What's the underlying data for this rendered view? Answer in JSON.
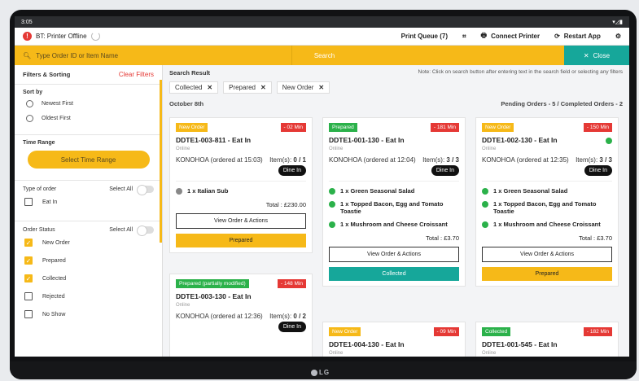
{
  "status_bar": {
    "time": "3:05"
  },
  "header": {
    "printer_status": "BT: Printer Offline",
    "print_queue": "Print Queue (7)",
    "connect_printer": "Connect Printer",
    "restart_app": "Restart App"
  },
  "search": {
    "placeholder": "Type Order ID or Item Name",
    "search_label": "Search",
    "close_label": "Close"
  },
  "sidebar": {
    "title": "Filters & Sorting",
    "clear": "Clear Filters",
    "sort_label": "Sort by",
    "sort_options": [
      "Newest First",
      "Oldest First"
    ],
    "time_range_label": "Time Range",
    "time_range_button": "Select Time Range",
    "type_label": "Type of order",
    "select_all": "Select All",
    "type_options": [
      "Eat In"
    ],
    "status_label": "Order Status",
    "status_options": [
      "New Order",
      "Prepared",
      "Collected",
      "Rejected",
      "No Show"
    ]
  },
  "results": {
    "title": "Search Result",
    "note": "Note: Click on search button after entering text in the search field or selecting any filters",
    "chips": [
      "Collected",
      "Prepared",
      "New Order"
    ],
    "date": "October 8th",
    "summary": "Pending Orders - 5 / Completed Orders - 2"
  },
  "orders": [
    {
      "status": "New Order",
      "time": "- 02 Min",
      "id": "DDTE1-003-811 - Eat In",
      "channel": "Online",
      "customer": "KONOHOA (ordered at 15:03)",
      "items_label": "Item(s):",
      "items_count": "0 / 1",
      "dine": "Dine In",
      "lines": [
        "1 x Italian Sub"
      ],
      "total": "Total : £230.00",
      "view": "View Order & Actions",
      "action": "Prepared"
    },
    {
      "status": "Prepared",
      "time": "- 181 Min",
      "id": "DDTE1-001-130 - Eat In",
      "channel": "Online",
      "customer": "KONOHOA (ordered at 12:04)",
      "items_label": "Item(s):",
      "items_count": "3 / 3",
      "dine": "Dine In",
      "lines": [
        "1 x Green Seasonal Salad",
        "1 x Topped Bacon, Egg and Tomato Toastie",
        "1 x Mushroom and Cheese Croissant"
      ],
      "total": "Total : £3.70",
      "view": "View Order & Actions",
      "action": "Collected"
    },
    {
      "status": "New Order",
      "time": "- 150 Min",
      "id": "DDTE1-002-130 - Eat In",
      "channel": "Online",
      "customer": "KONOHOA (ordered at 12:35)",
      "items_label": "Item(s):",
      "items_count": "3 / 3",
      "dine": "Dine In",
      "lines": [
        "1 x Green Seasonal Salad",
        "1 x Topped Bacon, Egg and Tomato Toastie",
        "1 x Mushroom and Cheese Croissant"
      ],
      "total": "Total : £3.70",
      "view": "View Order & Actions",
      "action": "Prepared"
    },
    {
      "status": "Prepared (partially modified)",
      "time": "- 148 Min",
      "id": "DDTE1-003-130 - Eat In",
      "channel": "Online",
      "customer": "KONOHOA (ordered at 12:36)",
      "items_label": "Item(s):",
      "items_count": "0 / 2",
      "dine": "Dine In"
    },
    {
      "status": "New Order",
      "time": "- 09 Min",
      "id": "DDTE1-004-130 - Eat In",
      "channel": "Online"
    },
    {
      "status": "Collected",
      "time": "- 182 Min",
      "id": "DDTE1-001-545 - Eat In",
      "channel": "Online"
    }
  ],
  "device": {
    "brand": "LG"
  },
  "colors": {
    "accent": "#f6b918",
    "teal": "#16a79a",
    "alert": "#e53935",
    "success": "#2bb14a"
  }
}
